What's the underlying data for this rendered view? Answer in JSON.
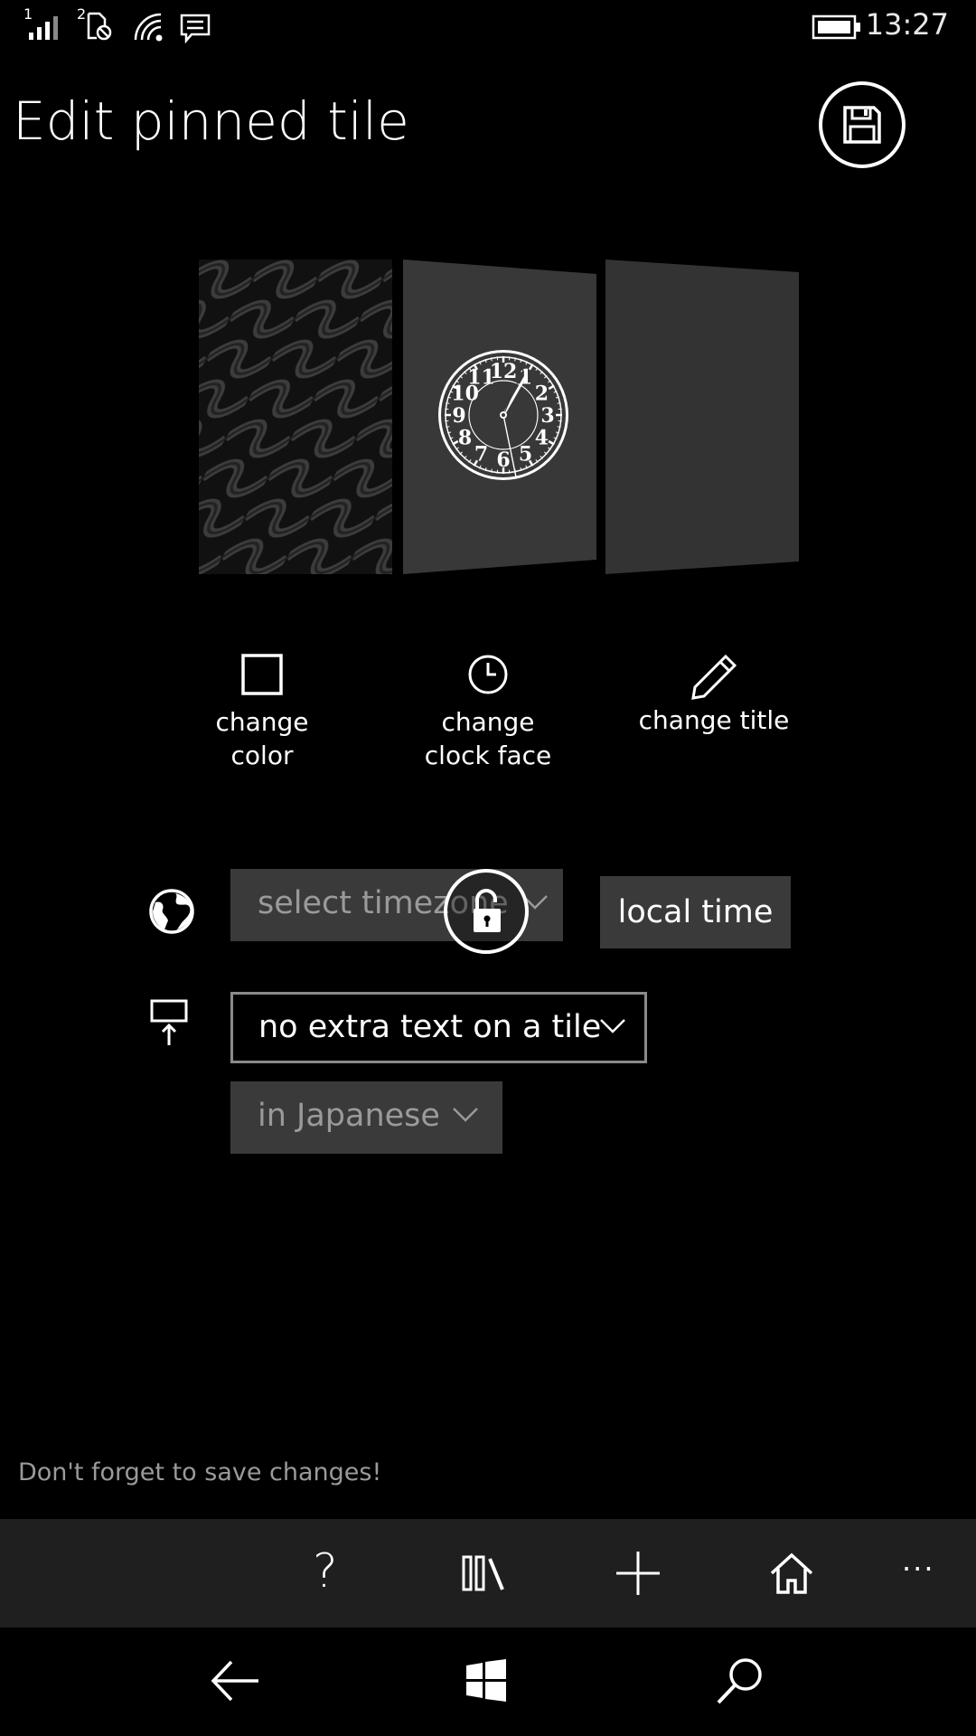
{
  "status_bar": {
    "sim1_label": "1",
    "sim2_label": "2",
    "time": "13:27",
    "icons": [
      "signal-icon",
      "sim2-no-service-icon",
      "wifi-icon",
      "message-icon",
      "battery-icon"
    ]
  },
  "header": {
    "title": "Edit pinned tile",
    "save_icon": "floppy-disk-icon"
  },
  "tiles": {
    "clock_numbers": [
      "12",
      "1",
      "2",
      "3",
      "4",
      "5",
      "6",
      "7",
      "8",
      "9",
      "10",
      "11"
    ]
  },
  "actions": [
    {
      "icon": "square-icon",
      "label_line1": "change",
      "label_line2": "color"
    },
    {
      "icon": "clock-icon",
      "label_line1": "change",
      "label_line2": "clock face"
    },
    {
      "icon": "pencil-icon",
      "label_line1": "change title",
      "label_line2": ""
    }
  ],
  "timezone": {
    "placeholder": "select timezone",
    "local_time_button": "local time"
  },
  "extra_text": {
    "selected": "no extra text on a tile",
    "language": "in Japanese"
  },
  "hint": "Don't forget to save changes!",
  "app_bar": {
    "icons": [
      "help-icon",
      "library-icon",
      "add-icon",
      "home-icon",
      "more-icon"
    ],
    "help_glyph": "?",
    "more_glyph": "···"
  },
  "nav_bar": {
    "icons": [
      "back-icon",
      "windows-icon",
      "search-icon"
    ]
  },
  "colors": {
    "background": "#000000",
    "tile": "#333333",
    "control": "#3a3a3a",
    "app_bar": "#1f1f1f",
    "muted_text": "#9a9a9a"
  }
}
